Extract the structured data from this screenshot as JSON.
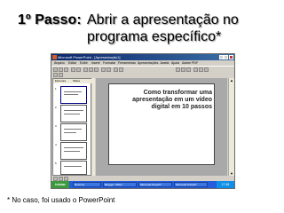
{
  "heading": {
    "step_label": "1º Passo:",
    "line1": "Abrir a apresentação no",
    "line2": "programa específico*"
  },
  "footnote": "* No caso, foi usado o PowerPoint",
  "window": {
    "title": "Microsoft PowerPoint - [Apresentação1]",
    "menu": [
      "Arquivo",
      "Editar",
      "Exibir",
      "Inserir",
      "Formatar",
      "Ferramentas",
      "Apresentações",
      "Janela",
      "Ajuda",
      "Adobe PDF"
    ],
    "outline_tabs": [
      "Estrutura",
      "Slides"
    ],
    "slide_numbers": [
      "1",
      "2",
      "3",
      "4",
      "5"
    ],
    "slide_title": "Como transformar uma apresentação em um vídeo digital em 10 passos"
  },
  "taskbar": {
    "start_label": "iniciar",
    "tasks": [
      "Resumo",
      "Blogger: Office",
      "Microsoft PowerP",
      "Microsoft PowerP"
    ],
    "clock": "17:48"
  },
  "colors": {
    "titlebar": "#0a246a",
    "taskbar": "#245edb",
    "start_button": "#3c9a3c",
    "chrome": "#d4d0c8"
  }
}
